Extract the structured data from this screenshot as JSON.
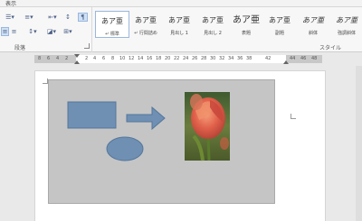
{
  "ribbon": {
    "tab_label": "表示",
    "paragraph_group_label": "段落",
    "styles_group_label": "スタイル",
    "styles": [
      {
        "sample": "あア亜",
        "name": "↵ 標準",
        "selected": true
      },
      {
        "sample": "あア亜",
        "name": "↵ 行間詰め",
        "selected": false
      },
      {
        "sample": "あア亜",
        "name": "見出し 1",
        "selected": false
      },
      {
        "sample": "あア亜",
        "name": "見出し 2",
        "selected": false
      },
      {
        "sample": "あア亜",
        "name": "表題",
        "selected": false
      },
      {
        "sample": "あア亜",
        "name": "副題",
        "selected": false
      },
      {
        "sample": "あア亜",
        "name": "斜体",
        "selected": false
      },
      {
        "sample": "あア亜",
        "name": "強調斜体",
        "selected": false
      }
    ]
  },
  "ruler": {
    "numbers": [
      "8",
      "6",
      "4",
      "2",
      "2",
      "4",
      "6",
      "8",
      "10",
      "12",
      "14",
      "16",
      "18",
      "20",
      "22",
      "24",
      "26",
      "28",
      "30",
      "32",
      "34",
      "36",
      "38",
      "42",
      "44",
      "46",
      "48"
    ]
  },
  "document": {
    "image_alt": "tulip-photo",
    "colors": {
      "canvas": "#c5c5c5",
      "shape_fill": "#6f8fb3",
      "shape_stroke": "#55779c"
    }
  }
}
